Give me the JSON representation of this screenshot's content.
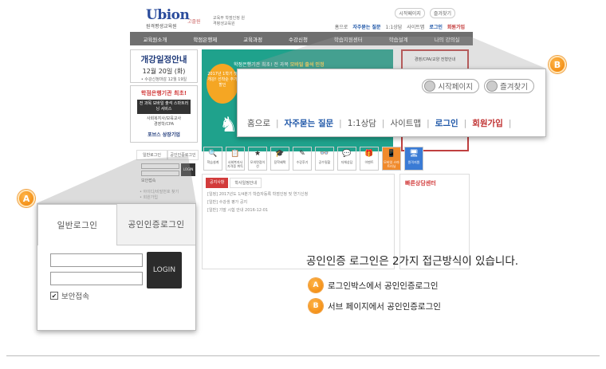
{
  "site": {
    "logo": "Ubion",
    "logo_sub": "원격평생교육원",
    "brand2": "고졸원",
    "brand2_desc": "교육부 학점인정 원격평생교육원",
    "top_util": [
      "시작페이지",
      "즐겨찾기"
    ],
    "top_links": [
      {
        "label": "홈으로",
        "style": "normal"
      },
      {
        "label": "자주묻는 질문",
        "style": "hi"
      },
      {
        "label": "1:1상담",
        "style": "normal"
      },
      {
        "label": "사이트맵",
        "style": "normal"
      },
      {
        "label": "로그인",
        "style": "hi"
      },
      {
        "label": "회원가입",
        "style": "red"
      }
    ],
    "gnb": [
      "교육원소개",
      "학점은행제",
      "교육과정",
      "수강신청",
      "학습지원센터",
      "학습설계",
      "나의 강의실"
    ],
    "ad": {
      "title": "개강일정안내",
      "date": "12월 20일 (화)",
      "note": "• 수강신청마감 12월 19일"
    },
    "promo": {
      "title": "학점은행기관 최초!",
      "dark": "전 과목 모바일 출석 스마트러닝 서비스",
      "lines": [
        "사회복지사/보육교사",
        "경영학/CPA"
      ],
      "brand": "포브스 상장기업"
    },
    "banner": {
      "top": "학점은행기관 최초! 전 과목",
      "top_em": "모바일 출석 인정",
      "circle": "2017년 1학기 첫 개강! 선착순 추가할인"
    },
    "rside_head": "경영/CPA/교양 전형안내",
    "login_tabs": [
      "일반로그인",
      "공인인증로그인"
    ],
    "mini_login_btn": "LOGIN",
    "mini_check": "보안접속",
    "mini_links": [
      "• 아이디/비밀번호 찾기",
      "• 회원가입"
    ],
    "quick": [
      {
        "icon": "🔍",
        "label": "학습설계"
      },
      {
        "icon": "📋",
        "label": "사회복지사 자격증 취득"
      },
      {
        "icon": "★",
        "label": "모의면접이선"
      },
      {
        "icon": "🎓",
        "label": "장학혜택"
      },
      {
        "icon": "✎",
        "label": "수강후기"
      },
      {
        "icon": "👓",
        "label": "공수밀할"
      },
      {
        "icon": "💬",
        "label": "자체상담"
      },
      {
        "icon": "🎁",
        "label": "이벤트"
      },
      {
        "icon": "📱",
        "label": "모바일 스마트러닝"
      },
      {
        "icon": "🖥",
        "label": "원격지원"
      }
    ],
    "notice_tabs": [
      "공지사항",
      "학사일정안내"
    ],
    "notice_lines": [
      "[일정] 2017년도 1/4분기 학습자등록 학점인정 및 연기신청",
      "[일반] 수강생 평가 공지",
      "[일반] 기말 시험 안내 2016-12-01"
    ],
    "consult_head": "빠른상담센터"
  },
  "zoom_a": {
    "tab_general": "일반로그인",
    "tab_cert": "공인인증로그인",
    "login_btn": "LOGIN",
    "check_label": "보안접속",
    "check_mark": "✔"
  },
  "zoom_b": {
    "util": [
      "시작페이지",
      "즐겨찾기"
    ],
    "links": [
      {
        "label": "홈으로",
        "style": "normal"
      },
      {
        "label": "자주묻는 질문",
        "style": "hi"
      },
      {
        "label": "1:1상담",
        "style": "normal"
      },
      {
        "label": "사이트맵",
        "style": "normal"
      },
      {
        "label": "로그인",
        "style": "hi"
      },
      {
        "label": "회원가입",
        "style": "red"
      }
    ]
  },
  "badges": {
    "a": "A",
    "b": "B"
  },
  "description": {
    "headline": "공인인증 로그인은 2가지 접근방식이 있습니다.",
    "items": [
      {
        "badge": "A",
        "text": "로그인박스에서 공인인증로그인"
      },
      {
        "badge": "B",
        "text": "서브 페이지에서 공인인증로그인"
      }
    ]
  },
  "colors": {
    "accent_orange": "#ef7f00",
    "nav_gray": "#6f6f6f",
    "link_blue": "#1f57a8",
    "link_red": "#c03030",
    "banner_green": "#1fa28c"
  }
}
